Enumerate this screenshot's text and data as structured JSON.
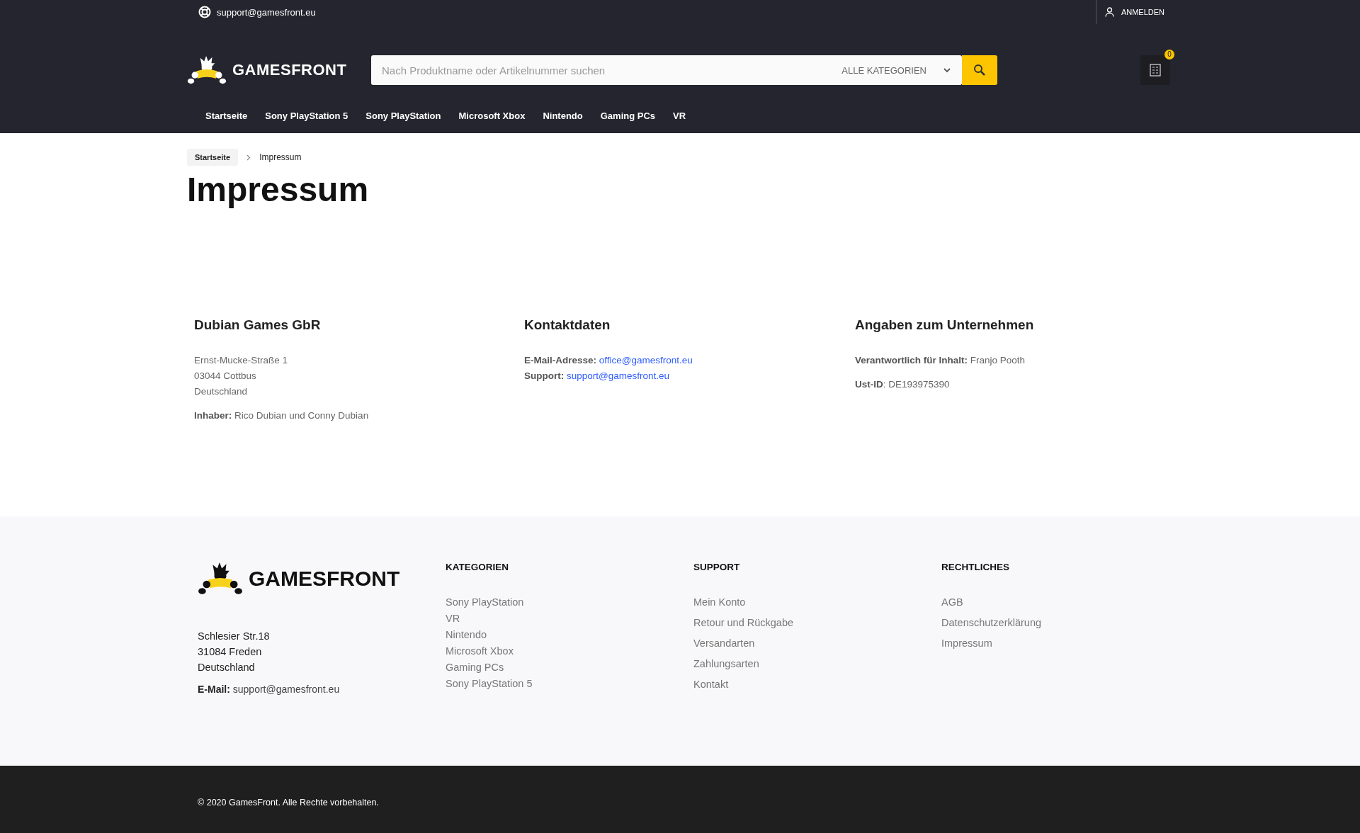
{
  "topbar": {
    "support_email": "support@gamesfront.eu",
    "login": "ANMELDEN"
  },
  "header": {
    "logo_text": "GAMESFRONT",
    "search": {
      "placeholder": "Nach Produktname oder Artikelnummer suchen",
      "category": "ALLE KATEGORIEN"
    },
    "cart_count": "0"
  },
  "nav": [
    "Startseite",
    "Sony PlayStation 5",
    "Sony PlayStation",
    "Microsoft Xbox",
    "Nintendo",
    "Gaming PCs",
    "VR"
  ],
  "breadcrumb": [
    {
      "label": "Startseite",
      "selected": false
    },
    {
      "label": "Impressum",
      "selected": true
    }
  ],
  "title": "Impressum",
  "columns": [
    {
      "heading": "Dubian Games GbR",
      "address": [
        "Ernst-Mucke-Straße 1",
        "03044 Cottbus",
        "Deutschland"
      ],
      "paragraphs": [
        "**Inhaber:** Rico Dubian und Conny Dubian"
      ]
    },
    {
      "heading": "Kontaktdaten",
      "contacts": [
        {
          "label": "E-Mail-Adresse:",
          "link": "office@gamesfront.eu"
        },
        {
          "label": "Support:",
          "link": "support@gamesfront.eu"
        }
      ]
    },
    {
      "heading": "Angaben zum Unternehmen",
      "paragraphs": [
        "**Verantwortlich für Inhalt:** Franjo Pooth",
        "**Ust-ID**: DE193975390"
      ]
    }
  ],
  "footer": {
    "logo_text": "GAMESFRONT",
    "address": [
      "Schlesier Str.18",
      "31084 Freden",
      "Deutschland"
    ],
    "email_label": "E-Mail:",
    "email": "support@gamesfront.eu",
    "columns": [
      {
        "heading": "KATEGORIEN",
        "links": [
          "Sony PlayStation",
          "VR",
          "Nintendo",
          "Microsoft Xbox",
          "Gaming PCs",
          "Sony PlayStation 5"
        ]
      },
      {
        "heading": "SUPPORT",
        "links": [
          "Mein Konto",
          "Retour und Rückgabe",
          "Versandarten",
          "Zahlungsarten",
          "Kontakt"
        ]
      },
      {
        "heading": "RECHTLICHES",
        "links": [
          "AGB",
          "Datenschutzerklärung",
          "Impressum"
        ]
      }
    ]
  },
  "copyright": "© 2020 GamesFront. Alle Rechte vorbehalten."
}
